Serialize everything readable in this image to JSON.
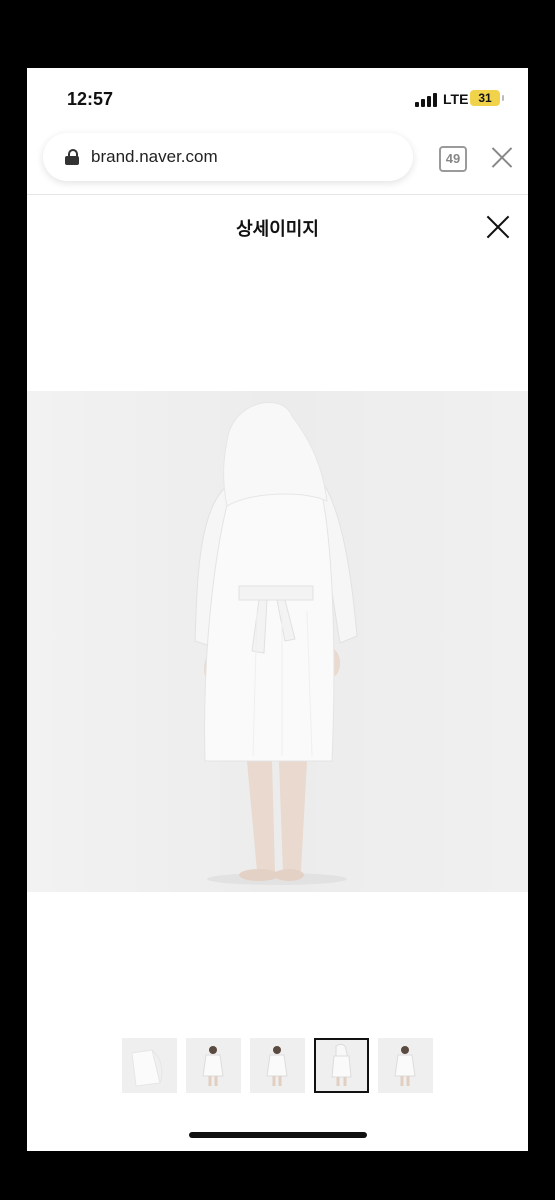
{
  "status_bar": {
    "time": "12:57",
    "network": "LTE",
    "battery": "31"
  },
  "browser": {
    "url": "brand.naver.com",
    "tab_count": "49"
  },
  "page": {
    "title": "상세이미지"
  },
  "thumbnails": {
    "count": 5,
    "selected_index": 3
  },
  "colors": {
    "background": "#ffffff",
    "image_bg": "#efefef",
    "robe": "#fafafa",
    "accent": "#111111"
  }
}
